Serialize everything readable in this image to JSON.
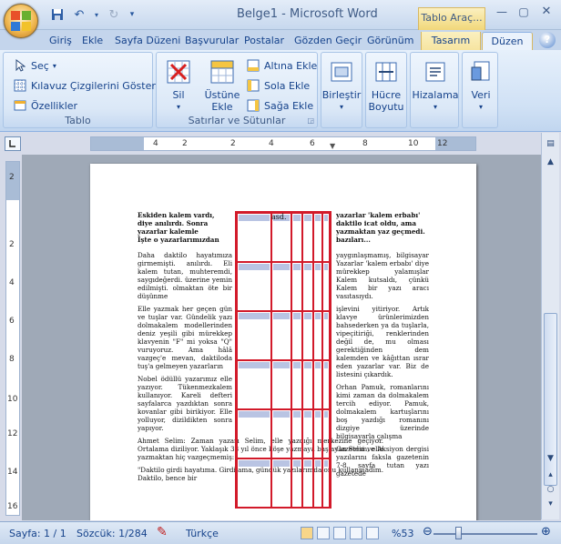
{
  "window": {
    "title": "Belge1 - Microsoft Word",
    "context_tab": "Tablo Araç..."
  },
  "tabs": [
    "Giriş",
    "Ekle",
    "Sayfa Düzeni",
    "Başvurular",
    "Postalar",
    "Gözden Geçir",
    "Görünüm",
    "Tasarım",
    "Düzen"
  ],
  "active_tab": "Düzen",
  "ribbon": {
    "tablo": {
      "label": "Tablo",
      "sec": "Seç",
      "kilavuz": "Kılavuz Çizgilerini Göster",
      "ozellikler": "Özellikler"
    },
    "satirlar": {
      "label": "Satırlar ve Sütunlar",
      "sil": "Sil",
      "ustune_line1": "Üstüne",
      "ustune_line2": "Ekle",
      "altina": "Altına Ekle",
      "sola": "Sola Ekle",
      "saga": "Sağa Ekle"
    },
    "birlestir": "Birleştir",
    "hucre_line1": "Hücre",
    "hucre_line2": "Boyutu",
    "hizalama": "Hizalama",
    "veri": "Veri"
  },
  "ruler": {
    "h_numbers": [
      "4",
      "2",
      "2",
      "4",
      "6",
      "8",
      "10",
      "12"
    ],
    "v_numbers": [
      "2",
      "2",
      "4",
      "6",
      "8",
      "10",
      "12",
      "14",
      "16"
    ]
  },
  "document": {
    "left_col": {
      "heading": [
        "Eskiden kalem vardı,",
        "diye anılırdı. Sonra",
        "yazarlar kalemle",
        "İşte o yazarlarımızdan"
      ],
      "p1": "Daha daktilo hayatımıza girmemişti. anılırdı. Eli kalem tutan, muhteremdi, saygıdeğerdi. üzerine yemin edilmişti. olmaktan öte bir düşünme",
      "p2": "Elle yazmak her geçen gün ve tuşlar var. Gündelik yazı dolmakalem modellerinden deniz yeşili gibi mürekkep klavyenin \"F\" mi yoksa \"Q\" vuruyoruz. Ama hâlâ vazgeç'e mevan, daktiloda tuş'a gelmeyen yazarların",
      "p3": "Nobel ödüllü yazarımız elle yazıyor. Tükenmezkalem kullanıyor. Kareli defteri sayfalarca yazdıktan sonra kovanlar gibi birikiyor. Elle yolluyor, dizildikten sonra yapıyor.",
      "p4": "Ahmet Selim: Zaman yazarı Selim, elle yazdığı merkezine geçiyor. Ortalama diziliyor. Yaklaşık 38 yıl önce köşe yazmaya başlayan Selim, elle yazmaktan hiç vazgeçmemiş:",
      "p5": "\"Daktilo girdi hayatıma. Girdi ama, gündük yazılarımda onu kullanmadım. Daktilo, bence bir"
    },
    "right_col": {
      "heading": [
        "yazarlar 'kalem erbabı'",
        "daktilo icat oldu, ama",
        "yazmaktan yaz geçmedi.",
        "bazıları..."
      ],
      "p1": "yaygınlaşmamış, bilgisayar Yazarlar 'kalem erbabı' diye mürekkep yalamışlar Kalem kutsaldı, çünkü Kalem bir yazı aracı vasıtasıydı.",
      "p2": "işlevini yitiriyor. Artık klavye ürünlerimizden bahsederken ya da tuşlarla, vipeçitiriği, renklerinden değil de, mu olması gerektiğinden dem kalemden ve kâğıttan ısrar eden yazarlar var. Biz de listesini çıkardık.",
      "p3": "Orhan Pamuk, romanlarını kimi zaman da dolmakalem tercih ediyor. Pamuk, dolmakalem kartuşlarını boş yazdığı romanını dizgiye üzerinde bilgisayarla çalışma",
      "p4": "Gazetesi ve Aksiyon dergisi yazılarını faksla gazetenin 7-8 sayfa tutan yazı gazetede"
    },
    "cell_text": "asd."
  },
  "status": {
    "page": "Sayfa: 1 / 1",
    "words": "Sözcük: 1/284",
    "language": "Türkçe",
    "zoom": "%53"
  },
  "colors": {
    "table_border": "#d21a2a",
    "ribbon_bg": "#dbe8f7"
  }
}
